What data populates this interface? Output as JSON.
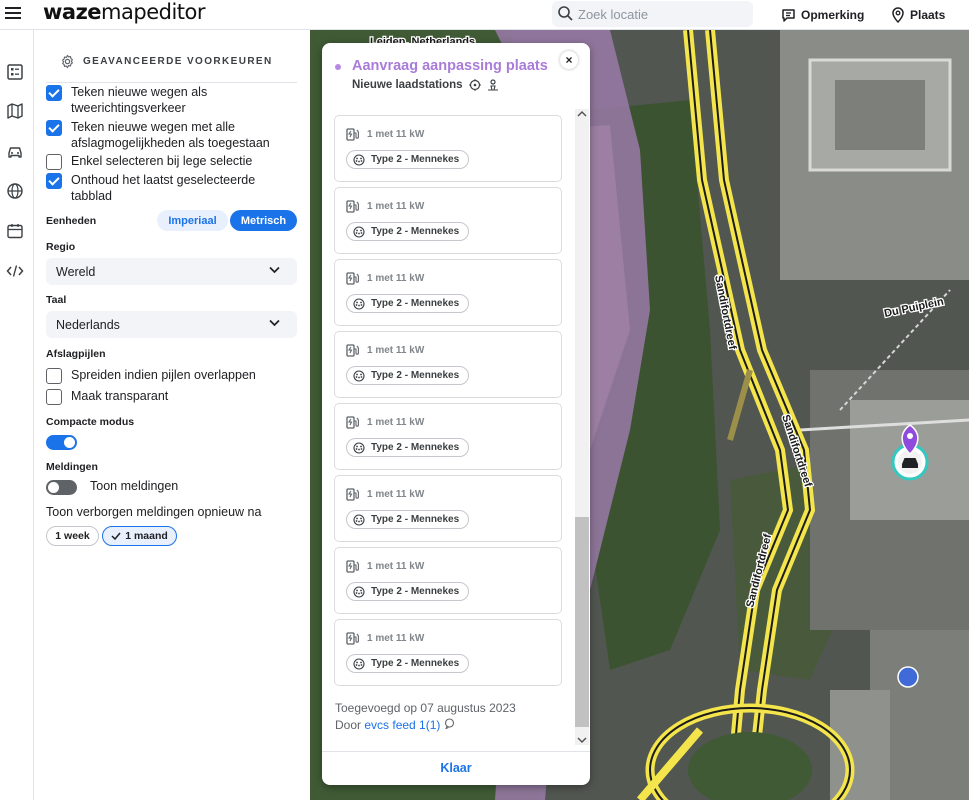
{
  "header": {
    "logo_bold": "waze",
    "logo_thin": "mapeditor",
    "search_placeholder": "Zoek locatie",
    "opmerking_label": "Opmerking",
    "plaats_label": "Plaats"
  },
  "settings": {
    "title": "GEAVANCEERDE VOORKEUREN",
    "checks": [
      {
        "label": "Teken nieuwe wegen als tweerichtingsverkeer",
        "checked": true
      },
      {
        "label": "Teken nieuwe wegen met alle afslagmogelijkheden als toegestaan",
        "checked": true
      },
      {
        "label": "Enkel selecteren bij lege selectie",
        "checked": false
      },
      {
        "label": "Onthoud het laatst geselecteerde tabblad",
        "checked": true
      }
    ],
    "units_label": "Eenheden",
    "units_imperial": "Imperiaal",
    "units_metric": "Metrisch",
    "region_label": "Regio",
    "region_value": "Wereld",
    "language_label": "Taal",
    "language_value": "Nederlands",
    "arrows_label": "Afslagpijlen",
    "arrows_checks": [
      {
        "label": "Spreiden indien pijlen overlappen",
        "checked": false
      },
      {
        "label": "Maak transparant",
        "checked": false
      }
    ],
    "compact_label": "Compacte modus",
    "compact_on": true,
    "notif_label": "Meldingen",
    "notif_toggle_label": "Toon meldingen",
    "notif_on": false,
    "hidden_label": "Toon verborgen meldingen opnieuw na",
    "hidden_week": "1 week",
    "hidden_month": "1 maand"
  },
  "map": {
    "top_label": "Leiden, Netherlands",
    "street_1": "Sandifortdreef",
    "street_2": "Sandifortdreef",
    "street_3": "Sandifortdreef",
    "street_4": "Du Puiplein"
  },
  "place": {
    "title": "Aanvraag aanpassing plaats",
    "subtitle": "Nieuwe laadstations",
    "chargers": [
      {
        "capacity": "1 met 11 kW",
        "connector": "Type 2 - Mennekes"
      },
      {
        "capacity": "1 met 11 kW",
        "connector": "Type 2 - Mennekes"
      },
      {
        "capacity": "1 met 11 kW",
        "connector": "Type 2 - Mennekes"
      },
      {
        "capacity": "1 met 11 kW",
        "connector": "Type 2 - Mennekes"
      },
      {
        "capacity": "1 met 11 kW",
        "connector": "Type 2 - Mennekes"
      },
      {
        "capacity": "1 met 11 kW",
        "connector": "Type 2 - Mennekes"
      },
      {
        "capacity": "1 met 11 kW",
        "connector": "Type 2 - Mennekes"
      },
      {
        "capacity": "1 met 11 kW",
        "connector": "Type 2 - Mennekes"
      }
    ],
    "added": "Toegevoegd op 07 augustus 2023",
    "by_prefix": "Door",
    "by_link": "evcs feed 1(1)",
    "done": "Klaar",
    "close": "×"
  },
  "colors": {
    "accent": "#1a73e8",
    "title_purple": "#a97cd9",
    "road_yellow": "#f3e54b",
    "marker_purple": "#8e4bdc"
  }
}
